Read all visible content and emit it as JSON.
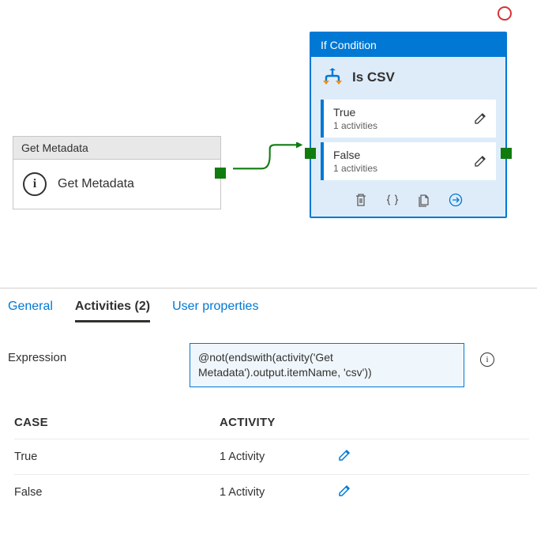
{
  "canvas": {
    "metadata_node": {
      "header": "Get Metadata",
      "label": "Get Metadata"
    },
    "if_node": {
      "header": "If Condition",
      "title": "Is CSV",
      "cases": [
        {
          "name": "True",
          "sub": "1 activities"
        },
        {
          "name": "False",
          "sub": "1 activities"
        }
      ]
    }
  },
  "panel": {
    "tabs": {
      "general": "General",
      "activities": "Activities (2)",
      "user_props": "User properties"
    },
    "expression_label": "Expression",
    "expression_value": "@not(endswith(activity('Get Metadata').output.itemName, 'csv'))",
    "table": {
      "col_case": "CASE",
      "col_activity": "ACTIVITY",
      "rows": [
        {
          "case": "True",
          "activity": "1 Activity"
        },
        {
          "case": "False",
          "activity": "1 Activity"
        }
      ]
    }
  }
}
